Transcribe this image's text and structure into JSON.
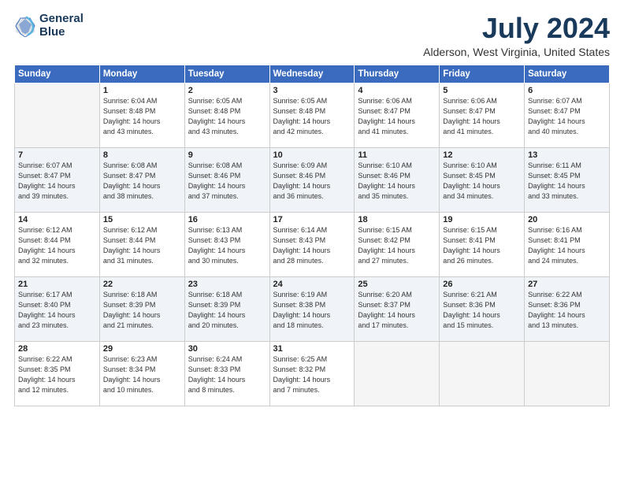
{
  "logo": {
    "line1": "General",
    "line2": "Blue"
  },
  "title": "July 2024",
  "subtitle": "Alderson, West Virginia, United States",
  "weekdays": [
    "Sunday",
    "Monday",
    "Tuesday",
    "Wednesday",
    "Thursday",
    "Friday",
    "Saturday"
  ],
  "weeks": [
    [
      {
        "day": "",
        "empty": true
      },
      {
        "day": "1",
        "sunrise": "6:04 AM",
        "sunset": "8:48 PM",
        "daylight": "14 hours and 43 minutes."
      },
      {
        "day": "2",
        "sunrise": "6:05 AM",
        "sunset": "8:48 PM",
        "daylight": "14 hours and 43 minutes."
      },
      {
        "day": "3",
        "sunrise": "6:05 AM",
        "sunset": "8:48 PM",
        "daylight": "14 hours and 42 minutes."
      },
      {
        "day": "4",
        "sunrise": "6:06 AM",
        "sunset": "8:47 PM",
        "daylight": "14 hours and 41 minutes."
      },
      {
        "day": "5",
        "sunrise": "6:06 AM",
        "sunset": "8:47 PM",
        "daylight": "14 hours and 41 minutes."
      },
      {
        "day": "6",
        "sunrise": "6:07 AM",
        "sunset": "8:47 PM",
        "daylight": "14 hours and 40 minutes."
      }
    ],
    [
      {
        "day": "7",
        "sunrise": "6:07 AM",
        "sunset": "8:47 PM",
        "daylight": "14 hours and 39 minutes."
      },
      {
        "day": "8",
        "sunrise": "6:08 AM",
        "sunset": "8:47 PM",
        "daylight": "14 hours and 38 minutes."
      },
      {
        "day": "9",
        "sunrise": "6:08 AM",
        "sunset": "8:46 PM",
        "daylight": "14 hours and 37 minutes."
      },
      {
        "day": "10",
        "sunrise": "6:09 AM",
        "sunset": "8:46 PM",
        "daylight": "14 hours and 36 minutes."
      },
      {
        "day": "11",
        "sunrise": "6:10 AM",
        "sunset": "8:46 PM",
        "daylight": "14 hours and 35 minutes."
      },
      {
        "day": "12",
        "sunrise": "6:10 AM",
        "sunset": "8:45 PM",
        "daylight": "14 hours and 34 minutes."
      },
      {
        "day": "13",
        "sunrise": "6:11 AM",
        "sunset": "8:45 PM",
        "daylight": "14 hours and 33 minutes."
      }
    ],
    [
      {
        "day": "14",
        "sunrise": "6:12 AM",
        "sunset": "8:44 PM",
        "daylight": "14 hours and 32 minutes."
      },
      {
        "day": "15",
        "sunrise": "6:12 AM",
        "sunset": "8:44 PM",
        "daylight": "14 hours and 31 minutes."
      },
      {
        "day": "16",
        "sunrise": "6:13 AM",
        "sunset": "8:43 PM",
        "daylight": "14 hours and 30 minutes."
      },
      {
        "day": "17",
        "sunrise": "6:14 AM",
        "sunset": "8:43 PM",
        "daylight": "14 hours and 28 minutes."
      },
      {
        "day": "18",
        "sunrise": "6:15 AM",
        "sunset": "8:42 PM",
        "daylight": "14 hours and 27 minutes."
      },
      {
        "day": "19",
        "sunrise": "6:15 AM",
        "sunset": "8:41 PM",
        "daylight": "14 hours and 26 minutes."
      },
      {
        "day": "20",
        "sunrise": "6:16 AM",
        "sunset": "8:41 PM",
        "daylight": "14 hours and 24 minutes."
      }
    ],
    [
      {
        "day": "21",
        "sunrise": "6:17 AM",
        "sunset": "8:40 PM",
        "daylight": "14 hours and 23 minutes."
      },
      {
        "day": "22",
        "sunrise": "6:18 AM",
        "sunset": "8:39 PM",
        "daylight": "14 hours and 21 minutes."
      },
      {
        "day": "23",
        "sunrise": "6:18 AM",
        "sunset": "8:39 PM",
        "daylight": "14 hours and 20 minutes."
      },
      {
        "day": "24",
        "sunrise": "6:19 AM",
        "sunset": "8:38 PM",
        "daylight": "14 hours and 18 minutes."
      },
      {
        "day": "25",
        "sunrise": "6:20 AM",
        "sunset": "8:37 PM",
        "daylight": "14 hours and 17 minutes."
      },
      {
        "day": "26",
        "sunrise": "6:21 AM",
        "sunset": "8:36 PM",
        "daylight": "14 hours and 15 minutes."
      },
      {
        "day": "27",
        "sunrise": "6:22 AM",
        "sunset": "8:36 PM",
        "daylight": "14 hours and 13 minutes."
      }
    ],
    [
      {
        "day": "28",
        "sunrise": "6:22 AM",
        "sunset": "8:35 PM",
        "daylight": "14 hours and 12 minutes."
      },
      {
        "day": "29",
        "sunrise": "6:23 AM",
        "sunset": "8:34 PM",
        "daylight": "14 hours and 10 minutes."
      },
      {
        "day": "30",
        "sunrise": "6:24 AM",
        "sunset": "8:33 PM",
        "daylight": "14 hours and 8 minutes."
      },
      {
        "day": "31",
        "sunrise": "6:25 AM",
        "sunset": "8:32 PM",
        "daylight": "14 hours and 7 minutes."
      },
      {
        "day": "",
        "empty": true
      },
      {
        "day": "",
        "empty": true
      },
      {
        "day": "",
        "empty": true
      }
    ]
  ],
  "labels": {
    "sunrise": "Sunrise:",
    "sunset": "Sunset:",
    "daylight": "Daylight:"
  }
}
